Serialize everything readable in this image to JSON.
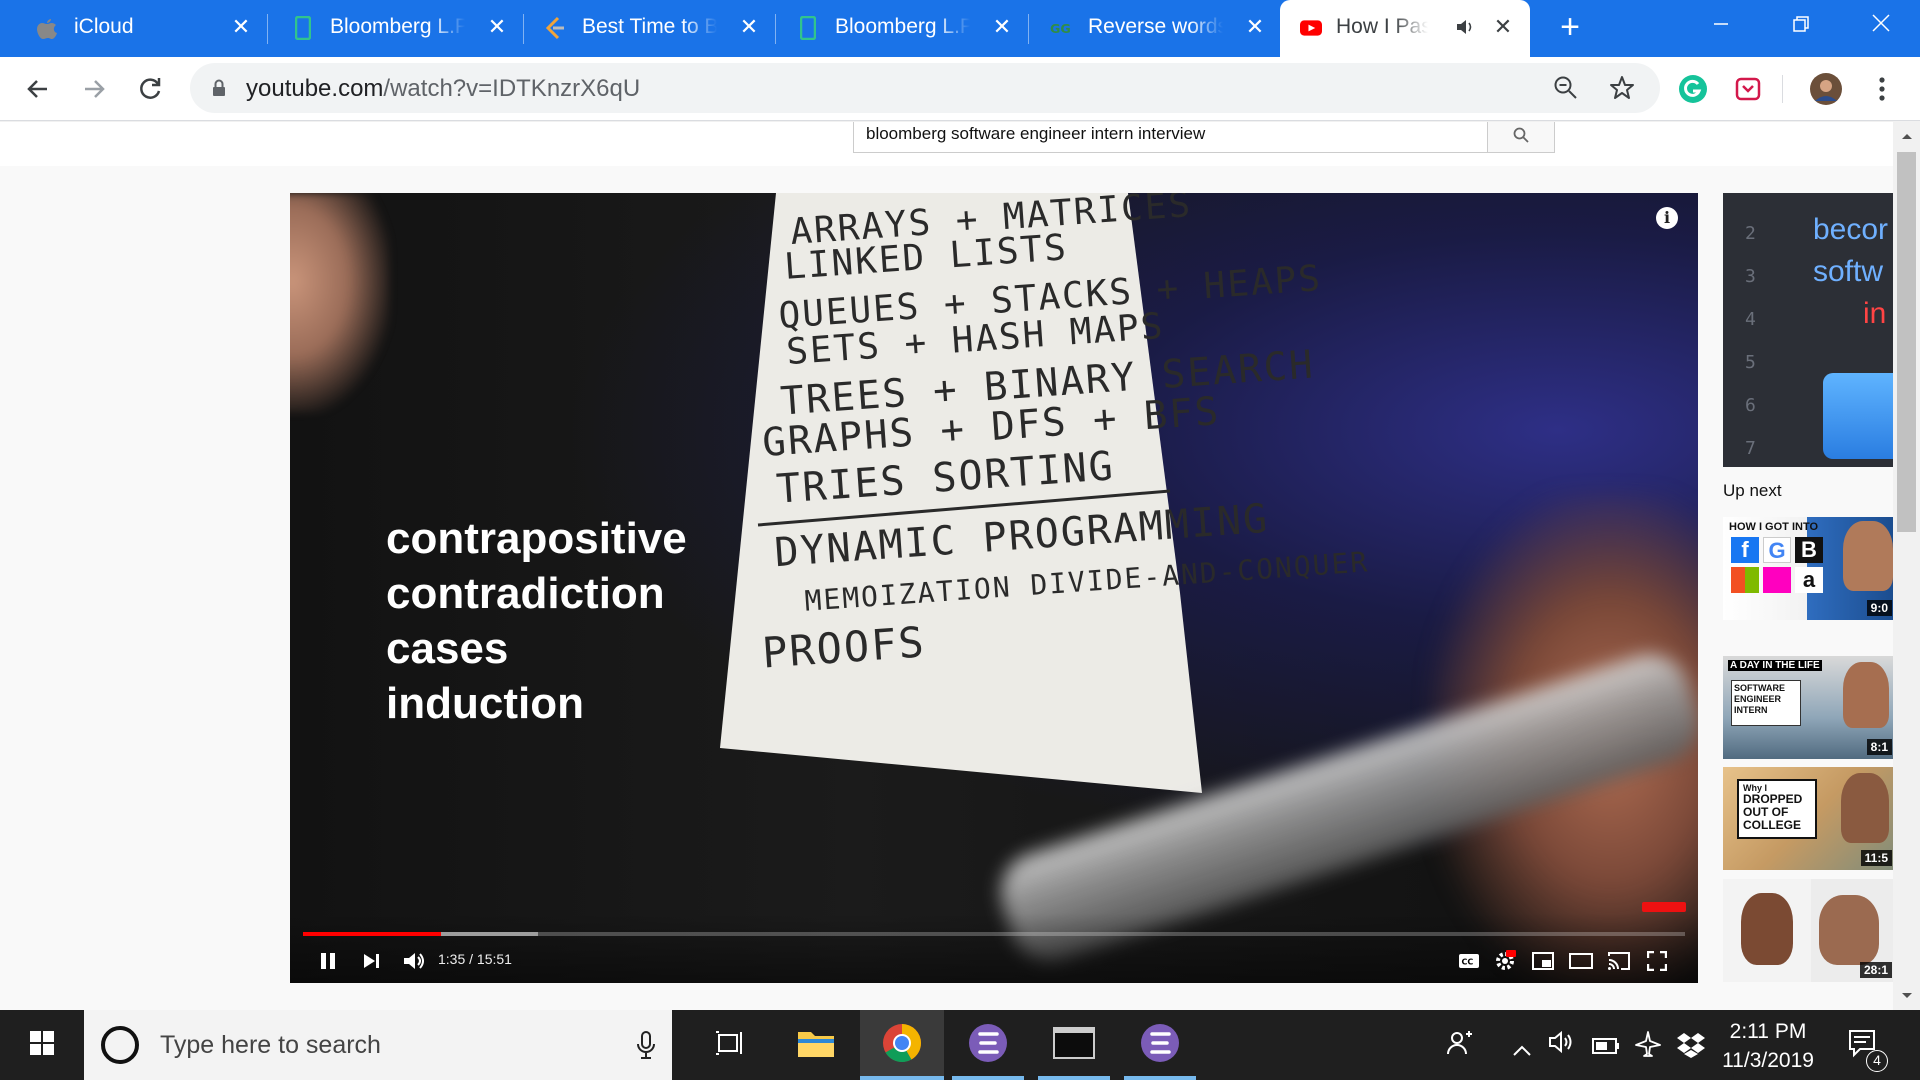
{
  "tabs": [
    {
      "label": "iCloud",
      "icon": "apple-icon",
      "active": false
    },
    {
      "label": "Bloomberg L.P.",
      "icon": "bloomberg-icon",
      "active": false
    },
    {
      "label": "Best Time to Buy",
      "icon": "leetcode-icon",
      "active": false
    },
    {
      "label": "Bloomberg L.P.",
      "icon": "bloomberg-icon",
      "active": false
    },
    {
      "label": "Reverse words",
      "icon": "geeksforgeeks-icon",
      "active": false
    },
    {
      "label": "How I Pass",
      "icon": "youtube-icon",
      "active": true,
      "audio": true
    }
  ],
  "tab_close": "✕",
  "address": {
    "domain": "youtube.com",
    "path": "/watch?v=IDTKnzrX6qU"
  },
  "search": {
    "query": "bloomberg software engineer intern interview"
  },
  "video": {
    "overlay_lines": [
      "contrapositive",
      "contradiction",
      "cases",
      "induction"
    ],
    "paper_lines": [
      "ARRAYS + MATRICES",
      "LINKED LISTS",
      "QUEUES + STACKS + HEAPS",
      "SETS + HASH MAPS",
      "TREES + BINARY SEARCH",
      "GRAPHS + DFS + BFS",
      "TRIES  SORTING",
      "DYNAMIC PROGRAMMING",
      "MEMOIZATION  DIVIDE-AND-CONQUER",
      "PROOFS"
    ],
    "time": "1:35 / 15:51",
    "played_fraction": 0.1,
    "buffered_fraction": 0.17,
    "info_label": "i"
  },
  "sidebar": {
    "preview_lines": [
      "2",
      "3",
      "4",
      "5",
      "6",
      "7"
    ],
    "preview_text": [
      "becor",
      "softw",
      "in"
    ],
    "up_next": "Up next",
    "videos": [
      {
        "title": "HOW I GOT INTO",
        "letters": [
          "f",
          "G",
          "B",
          "a"
        ],
        "duration": "9:0"
      },
      {
        "title": "A DAY IN THE LIFE",
        "sub": "SOFTWARE ENGINEER INTERN",
        "duration": "8:1"
      },
      {
        "title": "Why I",
        "sub": "DROPPED OUT OF COLLEGE",
        "duration": "11:5"
      },
      {
        "title": "",
        "duration": "28:1"
      }
    ]
  },
  "taskbar": {
    "search_placeholder": "Type here to search",
    "time": "2:11 PM",
    "date": "11/3/2019",
    "notification_count": "4"
  }
}
